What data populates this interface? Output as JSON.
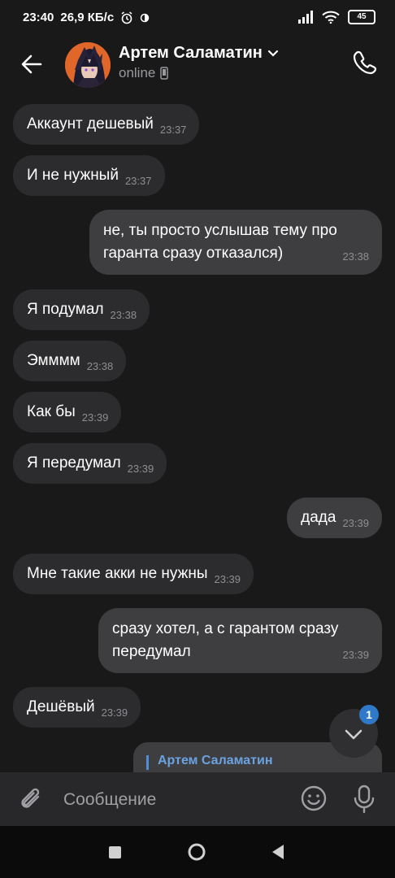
{
  "status_bar": {
    "time": "23:40",
    "speed": "26,9 КБ/с",
    "battery": "45",
    "icons": [
      "alarm-icon",
      "data-saver-icon",
      "signal-icon",
      "wifi-icon",
      "battery-icon"
    ]
  },
  "header": {
    "name": "Артем Саламатин",
    "status": "online",
    "icons": [
      "back-arrow-icon",
      "chevron-down-icon",
      "mobile-icon",
      "phone-icon"
    ]
  },
  "messages": [
    {
      "dir": "in",
      "text": "Аккаунт дешевый",
      "time": "23:37"
    },
    {
      "dir": "in",
      "text": "И не нужный",
      "time": "23:37"
    },
    {
      "dir": "out",
      "lines": [
        "не, ты просто услышав тему про",
        "гаранта сразу отказался)"
      ],
      "time": "23:38"
    },
    {
      "dir": "in",
      "text": "Я подумал",
      "time": "23:38"
    },
    {
      "dir": "in",
      "text": "Эмммм",
      "time": "23:38"
    },
    {
      "dir": "in",
      "text": "Как бы",
      "time": "23:39"
    },
    {
      "dir": "in",
      "text": "Я передумал",
      "time": "23:39"
    },
    {
      "dir": "out",
      "lines": [
        "дада"
      ],
      "time": "23:39"
    },
    {
      "dir": "in",
      "text": "Мне такие акки не нужны",
      "time": "23:39"
    },
    {
      "dir": "out",
      "lines": [
        "сразу хотел, а с гарантом сразу",
        "передумал"
      ],
      "time": "23:39"
    },
    {
      "dir": "in",
      "text": "Дешёвый",
      "time": "23:39"
    }
  ],
  "reply_preview": {
    "name": "Артем Саламатин"
  },
  "scroll_button": {
    "badge": "1"
  },
  "composer": {
    "placeholder": "Сообщение"
  },
  "colors": {
    "background": "#19191a",
    "incoming": "#2c2c2e",
    "outgoing": "#3e3e40",
    "accent": "#2f79c8"
  }
}
